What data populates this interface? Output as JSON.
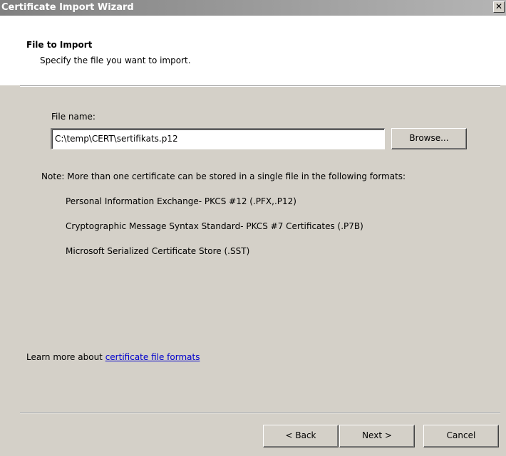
{
  "window": {
    "title": "Certificate Import Wizard",
    "close_glyph": "✕"
  },
  "header": {
    "title": "File to Import",
    "subtitle": "Specify the file you want to import."
  },
  "file": {
    "label": "File name:",
    "value": "C:\\temp\\CERT\\sertifikats.p12",
    "browse_label": "Browse..."
  },
  "note": {
    "text": "Note:  More than one certificate can be stored in a single file in the following formats:",
    "formats": [
      "Personal Information Exchange- PKCS #12 (.PFX,.P12)",
      "Cryptographic Message Syntax Standard- PKCS #7 Certificates (.P7B)",
      "Microsoft Serialized Certificate Store (.SST)"
    ]
  },
  "learn_more": {
    "prefix": "Learn more about ",
    "link_text": "certificate file formats"
  },
  "buttons": {
    "back": "< Back",
    "next": "Next >",
    "cancel": "Cancel"
  }
}
